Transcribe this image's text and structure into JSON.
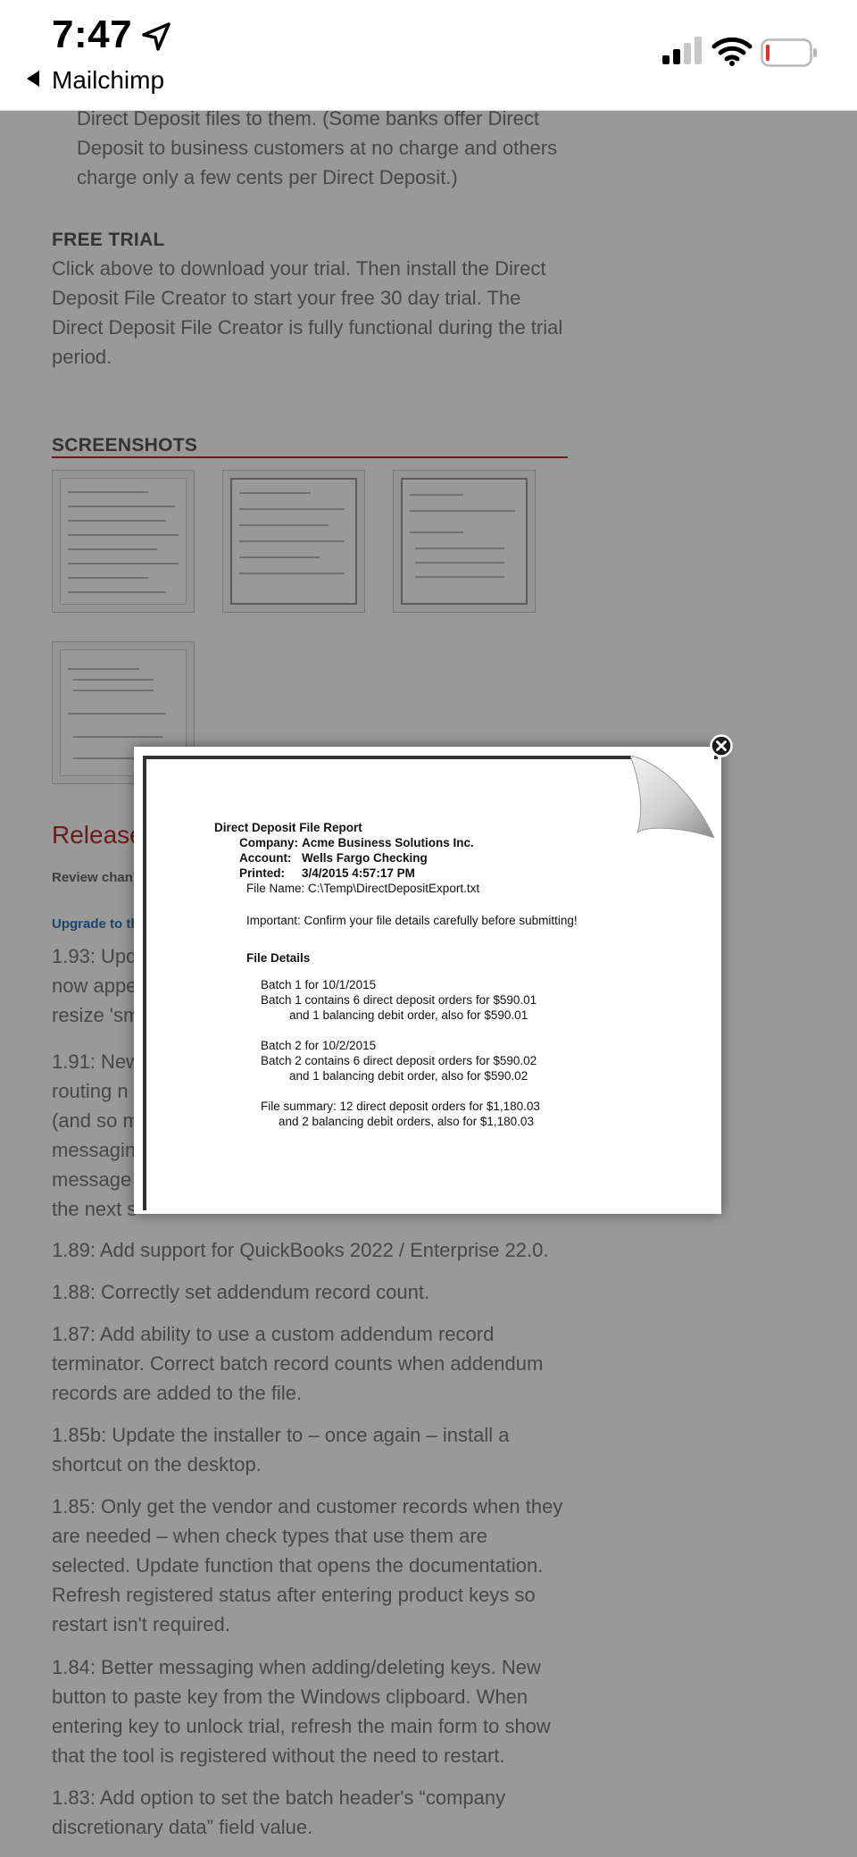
{
  "status_bar": {
    "time": "7:47",
    "back_app": "Mailchimp"
  },
  "page": {
    "intro_tail": "Direct Deposit files to them. (Some banks offer Direct Deposit to business customers at no charge and others charge only a few cents per Direct Deposit.)",
    "free_trial_heading": "FREE TRIAL",
    "free_trial_text": "Click above to download your trial.  Then install the Direct Deposit File Creator to start your free 30 day trial.  The Direct Deposit File Creator is fully functional during the trial period.",
    "screenshots_heading": "SCREENSHOTS",
    "release_heading": "Release",
    "review_label": "Review chan",
    "upgrade_label": "Upgrade to th",
    "notes": [
      "1.89: Add support for QuickBooks 2022 / Enterprise 22.0.",
      "1.88: Correctly set addendum record count.",
      "1.87: Add ability to use a custom addendum record terminator. Correct batch record counts when addendum records are added to the file.",
      "1.85b: Update the installer to – once again – install a shortcut on the desktop.",
      "1.85: Only get the vendor and customer records when they are needed  – when check types that use them are selected. Update function that opens the documentation. Refresh registered status after entering product keys so restart isn't required.",
      "1.84: Better messaging when adding/deleting keys. New button to paste key from the Windows clipboard. When entering key to unlock trial, refresh the main form to show that the tool is registered without the need to restart.",
      "1.83: Add option to set the batch header's “company discretionary data” field value."
    ],
    "partial_notes": {
      "n193_l1": "1.93: Upd",
      "n193_l2": "now appe",
      "n193_l3": "resize 'sm",
      "n191_l1": "1.91: New",
      "n191_l2": "routing n",
      "n191_l3": "(and so m",
      "n191_l4": "messagin",
      "n191_l5": "message",
      "n191_l6": "the next s"
    }
  },
  "report": {
    "title": "Direct Deposit File Report",
    "company_label": "Company:",
    "company": "Acme Business Solutions Inc.",
    "account_label": "Account:",
    "account": "Wells Fargo Checking",
    "printed_label": "Printed:",
    "printed": "3/4/2015 4:57:17 PM",
    "file_name": "File Name: C:\\Temp\\DirectDepositExport.txt",
    "important": "Important: Confirm your file details carefully before submitting!",
    "details_heading": "File Details",
    "batch1_head": "Batch 1 for 10/1/2015",
    "batch1_line1": "Batch 1 contains 6 direct deposit orders for $590.01",
    "batch1_line2": "and 1 balancing debit order, also for $590.01",
    "batch2_head": "Batch 2 for 10/2/2015",
    "batch2_line1": "Batch 2 contains 6 direct deposit orders for $590.02",
    "batch2_line2": "and 1 balancing debit order, also for $590.02",
    "summary_line1": "File summary: 12 direct deposit orders for $1,180.03",
    "summary_line2": "and 2 balancing debit orders, also for $1,180.03"
  },
  "icons": {
    "location": "location-arrow-icon",
    "signal": "cellular-signal-icon",
    "wifi": "wifi-icon",
    "battery": "battery-low-icon",
    "close": "close-icon",
    "page_curl": "page-curl-icon"
  },
  "colors": {
    "accent_red": "#b82c2c",
    "link_blue": "#2f73b5",
    "battery_low": "#e0302a"
  }
}
